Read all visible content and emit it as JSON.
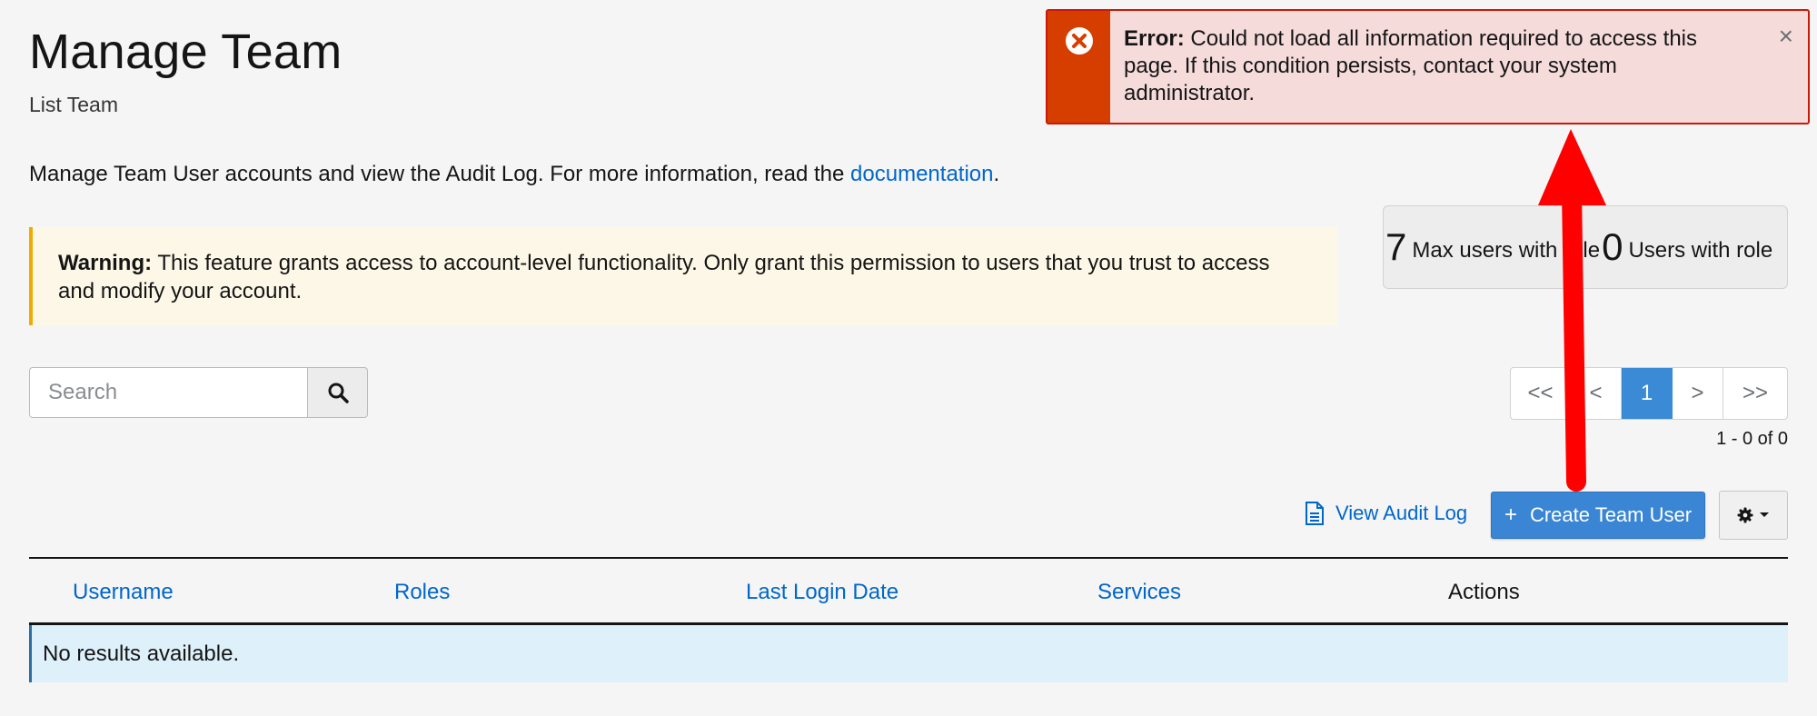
{
  "page": {
    "title": "Manage Team",
    "subtitle": "List Team",
    "description_prefix": "Manage Team User accounts and view the Audit Log. For more information, read the ",
    "description_link": "documentation",
    "description_suffix": "."
  },
  "warning": {
    "label": "Warning:",
    "text": " This feature grants access to account-level functionality. Only grant this permission to users that you trust to access and modify your account."
  },
  "stats": {
    "max_users_value": "7",
    "max_users_label": "Max users with role",
    "users_with_role_value": "0",
    "users_with_role_label": "Users with role"
  },
  "search": {
    "placeholder": "Search"
  },
  "pagination": {
    "first": "<<",
    "prev": "<",
    "current": "1",
    "next": ">",
    "last": ">>",
    "range": "1 - 0 of 0"
  },
  "toolbar": {
    "audit_log_label": "View Audit Log",
    "create_plus": "+",
    "create_label": "Create Team User"
  },
  "table": {
    "columns": [
      "Username",
      "Roles",
      "Last Login Date",
      "Services",
      "Actions"
    ],
    "empty_message": "No results available."
  },
  "alert": {
    "title": "Error:",
    "message": " Could not load all information required to access this page. If this condition persists, contact your system administrator.",
    "close": "×"
  },
  "colors": {
    "accent": "#0066cc",
    "primary_button": "#3a86d4",
    "alert_side": "#d63e00",
    "alert_bg": "#f6dbdb",
    "warning_border": "#f0ab00",
    "annotation_arrow": "#ff0000"
  },
  "icons": {
    "search": "search-icon",
    "audit": "document-icon",
    "gear": "gear-icon",
    "caret": "caret-down-icon",
    "error": "error-circle-icon",
    "close": "close-icon"
  }
}
